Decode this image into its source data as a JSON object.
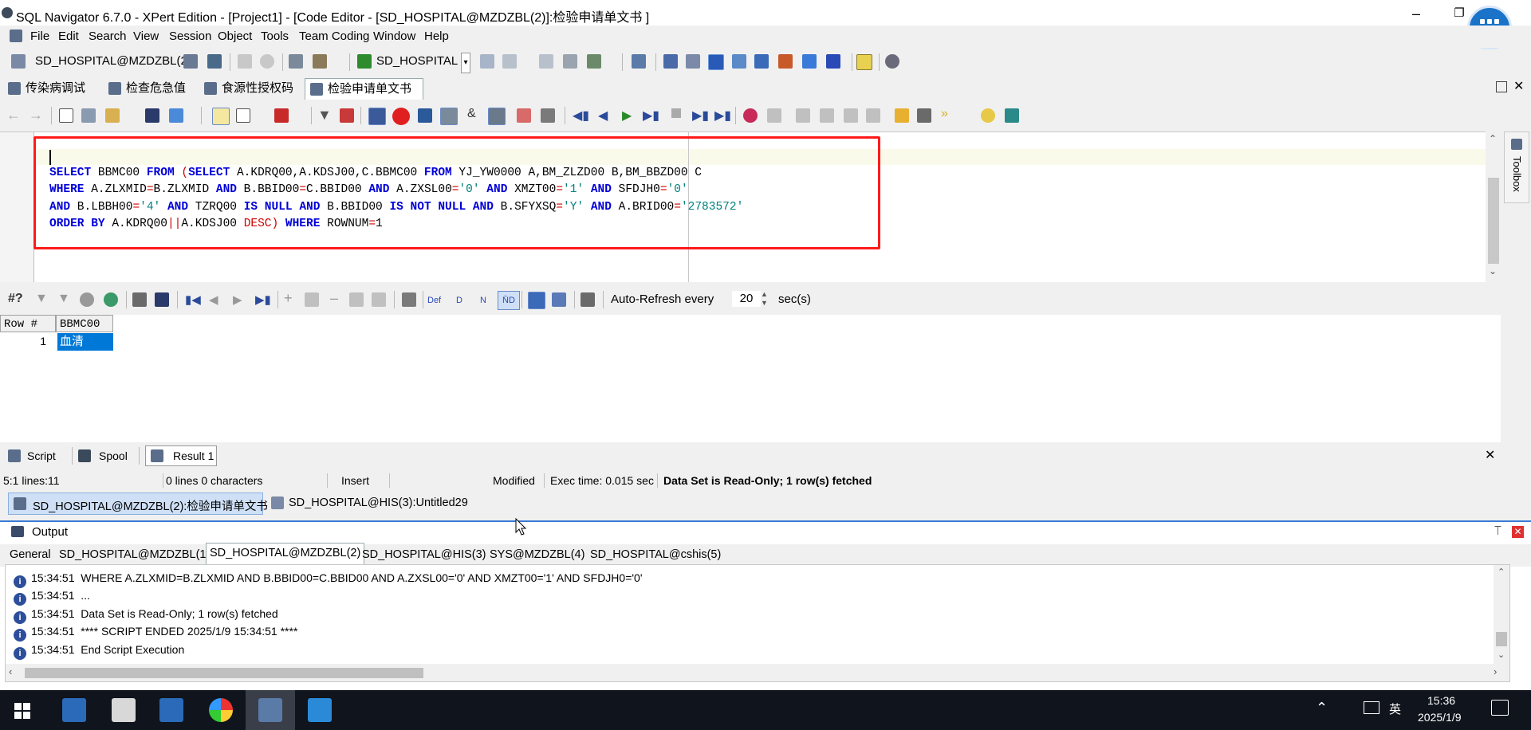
{
  "window": {
    "title": "SQL Navigator 6.7.0 - XPert Edition - [Project1] - [Code Editor - [SD_HOSPITAL@MZDZBL(2)]:检验申请单文书 ]",
    "minimize_icon": "minimize-icon",
    "restore_icon": "restore-icon",
    "close_icon": "close-icon"
  },
  "menu": [
    "File",
    "Edit",
    "Search",
    "View",
    "Session",
    "Object",
    "Tools",
    "Team Coding",
    "Window",
    "Help"
  ],
  "session_toolbar": {
    "connection": "SD_HOSPITAL@MZDZBL(2",
    "schema": "SD_HOSPITAL"
  },
  "doc_tabs": [
    "传染病调试",
    "检查危急值",
    "食源性授权码",
    "检验申请单文书"
  ],
  "editor": {
    "code_lines": [
      [
        {
          "t": "SELECT",
          "c": "kw"
        },
        {
          "t": " BBMC00 "
        },
        {
          "t": "FROM",
          "c": "kw"
        },
        {
          "t": " "
        },
        {
          "t": "(",
          "c": "op"
        },
        {
          "t": "SELECT",
          "c": "kw"
        },
        {
          "t": " A.KDRQ00,A.KDSJ00,C.BBMC00 "
        },
        {
          "t": "FROM",
          "c": "kw"
        },
        {
          "t": " YJ_YW0000 A,BM_ZLZD00 B,BM_BBZD00 C"
        }
      ],
      [
        {
          "t": "WHERE",
          "c": "kw"
        },
        {
          "t": " A.ZLXMID"
        },
        {
          "t": "=",
          "c": "op"
        },
        {
          "t": "B.ZLXMID "
        },
        {
          "t": "AND",
          "c": "kw"
        },
        {
          "t": " B.BBID00"
        },
        {
          "t": "=",
          "c": "op"
        },
        {
          "t": "C.BBID00 "
        },
        {
          "t": "AND",
          "c": "kw"
        },
        {
          "t": " A.ZXSL00"
        },
        {
          "t": "=",
          "c": "op"
        },
        {
          "t": "'0'",
          "c": "str"
        },
        {
          "t": " "
        },
        {
          "t": "AND",
          "c": "kw"
        },
        {
          "t": " XMZT00"
        },
        {
          "t": "=",
          "c": "op"
        },
        {
          "t": "'1'",
          "c": "str"
        },
        {
          "t": " "
        },
        {
          "t": "AND",
          "c": "kw"
        },
        {
          "t": " SFDJH0"
        },
        {
          "t": "=",
          "c": "op"
        },
        {
          "t": "'0'",
          "c": "str"
        }
      ],
      [
        {
          "t": "AND",
          "c": "kw"
        },
        {
          "t": " B.LBBH00"
        },
        {
          "t": "=",
          "c": "op"
        },
        {
          "t": "'4'",
          "c": "str"
        },
        {
          "t": " "
        },
        {
          "t": "AND",
          "c": "kw"
        },
        {
          "t": " TZRQ00 "
        },
        {
          "t": "IS NULL",
          "c": "kw"
        },
        {
          "t": " "
        },
        {
          "t": "AND",
          "c": "kw"
        },
        {
          "t": " B.BBID00 "
        },
        {
          "t": "IS NOT NULL",
          "c": "kw"
        },
        {
          "t": " "
        },
        {
          "t": "AND",
          "c": "kw"
        },
        {
          "t": " B.SFYXSQ"
        },
        {
          "t": "=",
          "c": "op"
        },
        {
          "t": "'Y'",
          "c": "str"
        },
        {
          "t": " "
        },
        {
          "t": "AND",
          "c": "kw"
        },
        {
          "t": " A.BRID00"
        },
        {
          "t": "=",
          "c": "op"
        },
        {
          "t": "'2783572'",
          "c": "str"
        }
      ],
      [
        {
          "t": "ORDER BY",
          "c": "kw"
        },
        {
          "t": " A.KDRQ00"
        },
        {
          "t": "||",
          "c": "op"
        },
        {
          "t": "A.KDSJ00 "
        },
        {
          "t": "DESC)",
          "c": "op"
        },
        {
          "t": " "
        },
        {
          "t": "WHERE",
          "c": "kw"
        },
        {
          "t": " ROWNUM"
        },
        {
          "t": "=",
          "c": "op"
        },
        {
          "t": "1"
        }
      ]
    ]
  },
  "result_toolbar": {
    "query_label": "#?",
    "def_label": "Def",
    "d_label": "D",
    "n_label": "N",
    "nd_label": "N̄D",
    "auto_refresh_label": "Auto-Refresh every",
    "auto_refresh_value": "20",
    "auto_refresh_unit": "sec(s)"
  },
  "grid": {
    "columns": [
      "Row #",
      "BBMC00"
    ],
    "rows": [
      [
        "1",
        "血清"
      ]
    ]
  },
  "bottom_tabs": [
    "Script",
    "Spool",
    "Result 1"
  ],
  "status_bar": {
    "position": "5:1 lines:11",
    "selection": "0 lines 0 characters",
    "mode": "Insert",
    "state": "Modified",
    "exec_time": "Exec time: 0.015 sec",
    "message": "Data Set is Read-Only; 1 row(s) fetched"
  },
  "window_tabs": [
    "SD_HOSPITAL@MZDZBL(2):检验申请单文书",
    "SD_HOSPITAL@HIS(3):Untitled29"
  ],
  "output": {
    "title": "Output",
    "tabs": [
      "General",
      "SD_HOSPITAL@MZDZBL(1)",
      "SD_HOSPITAL@MZDZBL(2)",
      "SD_HOSPITAL@HIS(3)",
      "SYS@MZDZBL(4)",
      "SD_HOSPITAL@cshis(5)"
    ],
    "log": [
      {
        "time": "15:34:51",
        "text": "WHERE A.ZLXMID=B.ZLXMID AND B.BBID00=C.BBID00 AND A.ZXSL00='0' AND XMZT00='1' AND SFDJH0='0'"
      },
      {
        "time": "15:34:51",
        "text": "..."
      },
      {
        "time": "15:34:51",
        "text": "Data Set is Read-Only; 1 row(s) fetched"
      },
      {
        "time": "15:34:51",
        "text": "**** SCRIPT ENDED 2025/1/9 15:34:51 ****"
      },
      {
        "time": "15:34:51",
        "text": "End Script Execution"
      }
    ]
  },
  "toolbox": {
    "label": "Toolbox"
  },
  "taskbar": {
    "ime": "英",
    "time": "15:36",
    "date": "2025/1/9"
  },
  "colors": {
    "keyword": "#0000d8",
    "string": "#008080",
    "operator": "#d00000",
    "highlight_box": "#ff1a1a",
    "selection": "#0078d7"
  }
}
